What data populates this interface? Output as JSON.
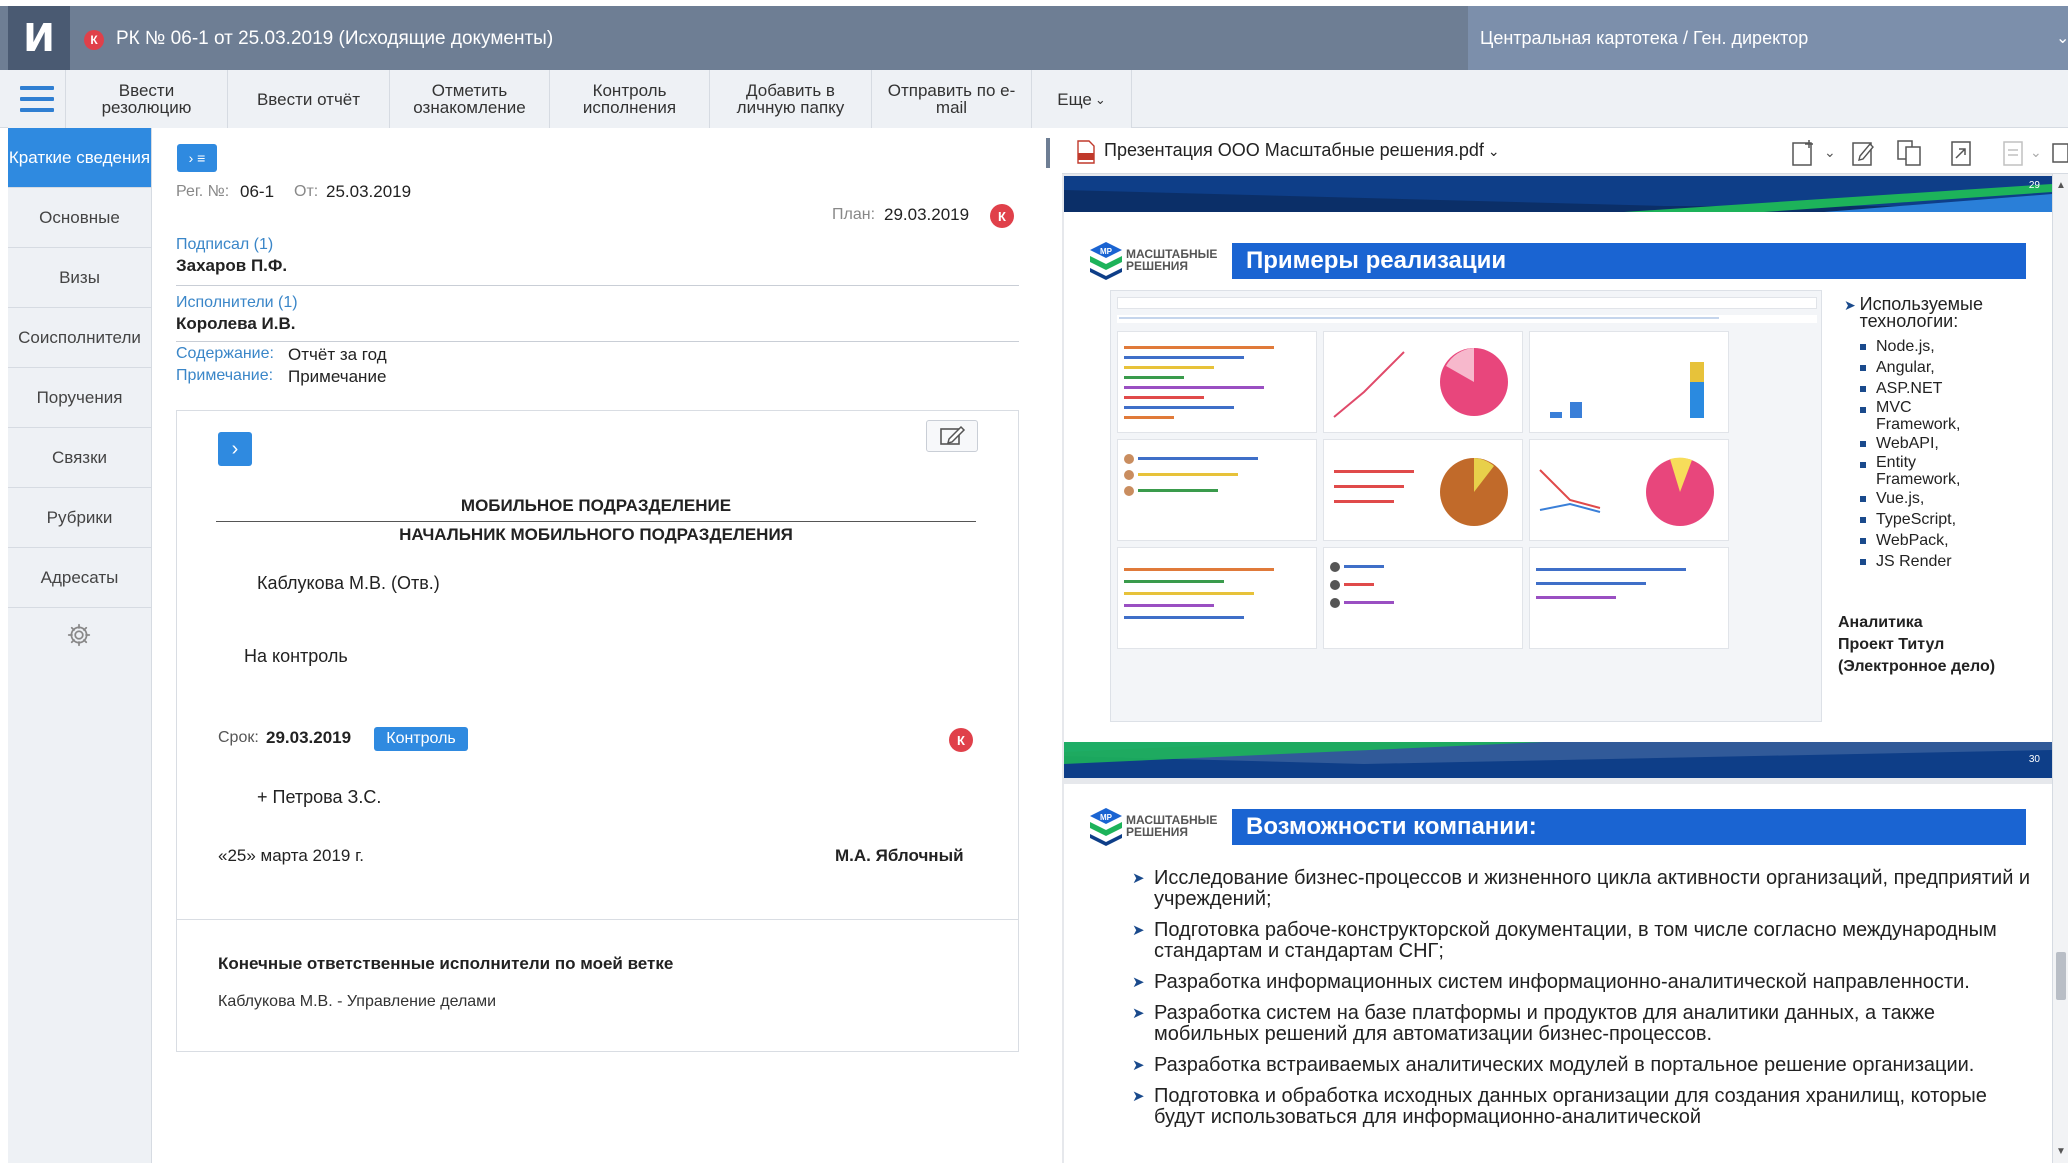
{
  "header": {
    "logo_letter": "И",
    "doc_badge": "К",
    "title": "РК № 06-1 от 25.03.2019 (Исходящие документы)",
    "context": "Центральная картотека / Ген. директор"
  },
  "toolbar": {
    "buttons": [
      "Ввести резолюцию",
      "Ввести отчёт",
      "Отметить ознакомление",
      "Контроль исполнения",
      "Добавить в личную папку",
      "Отправить по e-mail",
      "Еще"
    ]
  },
  "nav": {
    "items": [
      "Краткие сведения",
      "Основные",
      "Визы",
      "Соисполнители",
      "Поручения",
      "Связки",
      "Рубрики",
      "Адресаты"
    ]
  },
  "card": {
    "expand_label": "› ≡",
    "reg_label": "Рег. №:",
    "reg_value": "06-1",
    "from_label": "От:",
    "from_value": "25.03.2019",
    "plan_label": "План:",
    "plan_value": "29.03.2019",
    "plan_badge": "К",
    "signed_label": "Подписал (1)",
    "signed_value": "Захаров П.Ф.",
    "exec_label": "Исполнители (1)",
    "exec_value": "Королева И.В.",
    "content_label": "Содержание:",
    "content_value": "Отчёт за год",
    "note_label": "Примечание:",
    "note_value": "Примечание"
  },
  "resolution": {
    "arrow": "›",
    "unit": "МОБИЛЬНОЕ ПОДРАЗДЕЛЕНИЕ",
    "head": "НАЧАЛЬНИК МОБИЛЬНОГО ПОДРАЗДЕЛЕНИЯ",
    "executor": "Каблукова М.В.  (Отв.)",
    "text": "На контроль",
    "deadline_label": "Срок:",
    "deadline_value": "29.03.2019",
    "control_badge": "Контроль",
    "k_badge": "К",
    "plus_exec": "+ Петрова З.С.",
    "date": "«25» марта 2019 г.",
    "author": "М.А. Яблочный"
  },
  "final": {
    "title": "Конечные ответственные исполнители по моей ветке",
    "value": "Каблукова М.В. - Управление делами"
  },
  "pdf": {
    "file_name": "Презентация ООО Масштабные решения.pdf",
    "slide1": {
      "page_top": "29",
      "page_bottom": "30",
      "brand": "МАСШТАБНЫЕ РЕШЕНИЯ",
      "logo_text": "МР",
      "title": "Примеры реализации",
      "tech_title": "Используемые технологии:",
      "tech": [
        "Node.js,",
        "Angular,",
        "ASP.NET",
        "MVC Framework,",
        "WebAPI,",
        "Entity Framework,",
        "Vue.js,",
        "TypeScript,",
        "WebPack,",
        "JS Render"
      ],
      "footer": [
        "Аналитика",
        "Проект Титул",
        "(Электронное дело)"
      ]
    },
    "slide2": {
      "brand": "МАСШТАБНЫЕ РЕШЕНИЯ",
      "logo_text": "МР",
      "title": "Возможности компании:",
      "items": [
        "Исследование бизнес-процессов и жизненного цикла активности организаций, предприятий и учреждений;",
        "Подготовка рабоче-конструкторской документации, в том числе согласно международным стандартам и стандартам СНГ;",
        "Разработка информационных систем информационно-аналитической направленности.",
        "Разработка систем на базе  платформы и продуктов для аналитики данных, а также мобильных решений для автоматизации бизнес-процессов.",
        "Разработка встраиваемых аналитических модулей в портальное решение организации.",
        "Подготовка и обработка исходных данных организации для создания хранилищ, которые будут использоваться для информационно-аналитической"
      ]
    }
  },
  "colors": {
    "header": "#6e7e94",
    "accent": "#2f8ae0",
    "danger": "#e0404a",
    "slide_navy": "#0e3e88"
  }
}
